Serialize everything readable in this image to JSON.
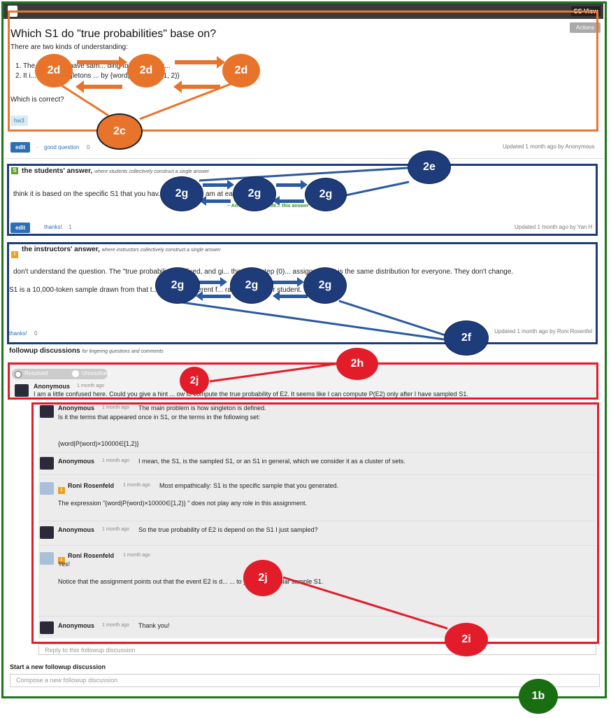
{
  "header": {
    "view_label": "SS View"
  },
  "question": {
    "actions_label": "Actions",
    "title": "Which S1 do \"true probabilities\" base on?",
    "intro": "There are two kinds of understanding:",
    "items": [
      "1. The ... that we have sam... ding to the distribu...",
      "2. It i... 1, and singletons ... by {word|P(wo... ∈ [1, 2)}"
    ],
    "closing": "Which is correct?",
    "tag": "hw3",
    "edit_label": "edit",
    "good_question_label": "good question",
    "good_question_count": "0",
    "updated": "Updated 1 month ago by Anonymous"
  },
  "students_answer": {
    "icon": "S",
    "heading": "the students' answer,",
    "subheading": "where students collectively construct a single answer",
    "text": "think it is based on the specific S1 that you hav... when you ... am at eac...",
    "endorse": "~ An... (Roni Rosenfe... this answer ~",
    "edit_label": "edit",
    "thanks_label": "thanks!",
    "thanks_count": "1",
    "updated": "Updated 1 month ago by Yan H"
  },
  "instructors_answer": {
    "icon": "i",
    "heading": "the instructors' answer,",
    "subheading": "where instructors collectively construct a single answer",
    "text1": "don't understand the question. The \"true probabili... are fixed, and gi... the file in step (0)... assignment. It is the same distribution for everyone. They don't change.",
    "text2": "S1 is a 10,000-token sample drawn from that t... Your S... different f... rawn by another student.",
    "thanks_label": "thanks!",
    "thanks_count": "0",
    "updated": "Updated 1 month ago by Roni Rosenfel"
  },
  "followups": {
    "heading": "followup discussions",
    "subheading": "for lingering questions and comments",
    "resolved_label": "Resolved",
    "unresolved_label": "Unresolved",
    "main_author": "Anonymous",
    "main_time": "1 month ago",
    "main_text": "I am a little confused here. Could you give a hint ... ow to compute the true probability of E2. It seems like I can compute P(E2) only after I have sampled S1.",
    "replies": [
      {
        "author": "Anonymous",
        "time": "1 month ago",
        "line1": "The main problem is how singleton is defined.",
        "line2": "Is it the terms that appeared once in S1, or the terms in the following set:",
        "line3": "{word|P(word)×10000∈[1,2)}"
      },
      {
        "author": "Anonymous",
        "time": "1 month ago",
        "line1": "I mean, the S1, is the sampled S1, or an S1 in general, which we consider it as a cluster of sets."
      },
      {
        "author": "Roni Rosenfeld",
        "time": "1 month ago",
        "line1": "Most empathically: S1 is the specific sample that you generated.",
        "line2": "The expression \"{word|P(word)×10000∈[1,2)} \" does not play any role in this assignment."
      },
      {
        "author": "Anonymous",
        "time": "1 month ago",
        "line1": "So the true probability of E2 is depend on the S1 I just sampled?"
      },
      {
        "author": "Roni Rosenfeld",
        "time": "1 month ago",
        "line1": "Yes!",
        "line2": "Notice that the assignment points out that the event E2 is d... ... to your apr... ticular sample S1."
      },
      {
        "author": "Anonymous",
        "time": "1 month ago",
        "line1": "Thank you!"
      }
    ],
    "reply_placeholder": "Reply to this followup discussion",
    "new_heading": "Start a new followup discussion",
    "new_placeholder": "Compose a new followup discussion"
  },
  "annotations": {
    "b2c": "2c",
    "b2d": "2d",
    "b2e": "2e",
    "b2f": "2f",
    "b2g": "2g",
    "b2h": "2h",
    "b2i": "2i",
    "b2j": "2j",
    "b1b": "1b"
  },
  "colors": {
    "green": "#1a7a1a",
    "orange": "#e87830",
    "navy": "#1e3c7a",
    "red": "#e31c2a"
  }
}
